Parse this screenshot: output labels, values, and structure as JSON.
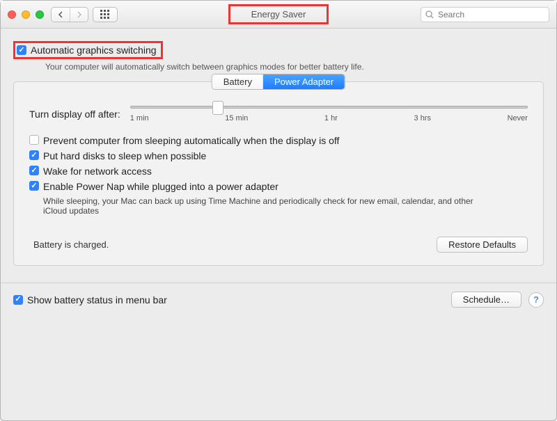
{
  "titlebar": {
    "title": "Energy Saver",
    "search_placeholder": "Search"
  },
  "auto_graphics": {
    "label": "Automatic graphics switching",
    "checked": true,
    "description": "Your computer will automatically switch between graphics modes for better battery life."
  },
  "tabs": {
    "battery": "Battery",
    "power_adapter": "Power Adapter",
    "active": "power_adapter"
  },
  "slider": {
    "label": "Turn display off after:",
    "ticks": [
      "1 min",
      "15 min",
      "1 hr",
      "3 hrs",
      "Never"
    ],
    "position_pct": 22
  },
  "options": [
    {
      "id": "prevent-sleep",
      "checked": false,
      "label": "Prevent computer from sleeping automatically when the display is off"
    },
    {
      "id": "hdd-sleep",
      "checked": true,
      "label": "Put hard disks to sleep when possible"
    },
    {
      "id": "wake-network",
      "checked": true,
      "label": "Wake for network access"
    },
    {
      "id": "power-nap",
      "checked": true,
      "label": "Enable Power Nap while plugged into a power adapter",
      "subtext": "While sleeping, your Mac can back up using Time Machine and periodically check for new email, calendar, and other iCloud updates"
    }
  ],
  "status_text": "Battery is charged.",
  "buttons": {
    "restore_defaults": "Restore Defaults",
    "schedule": "Schedule…"
  },
  "bottom_checkbox": {
    "label": "Show battery status in menu bar",
    "checked": true
  },
  "help_glyph": "?"
}
